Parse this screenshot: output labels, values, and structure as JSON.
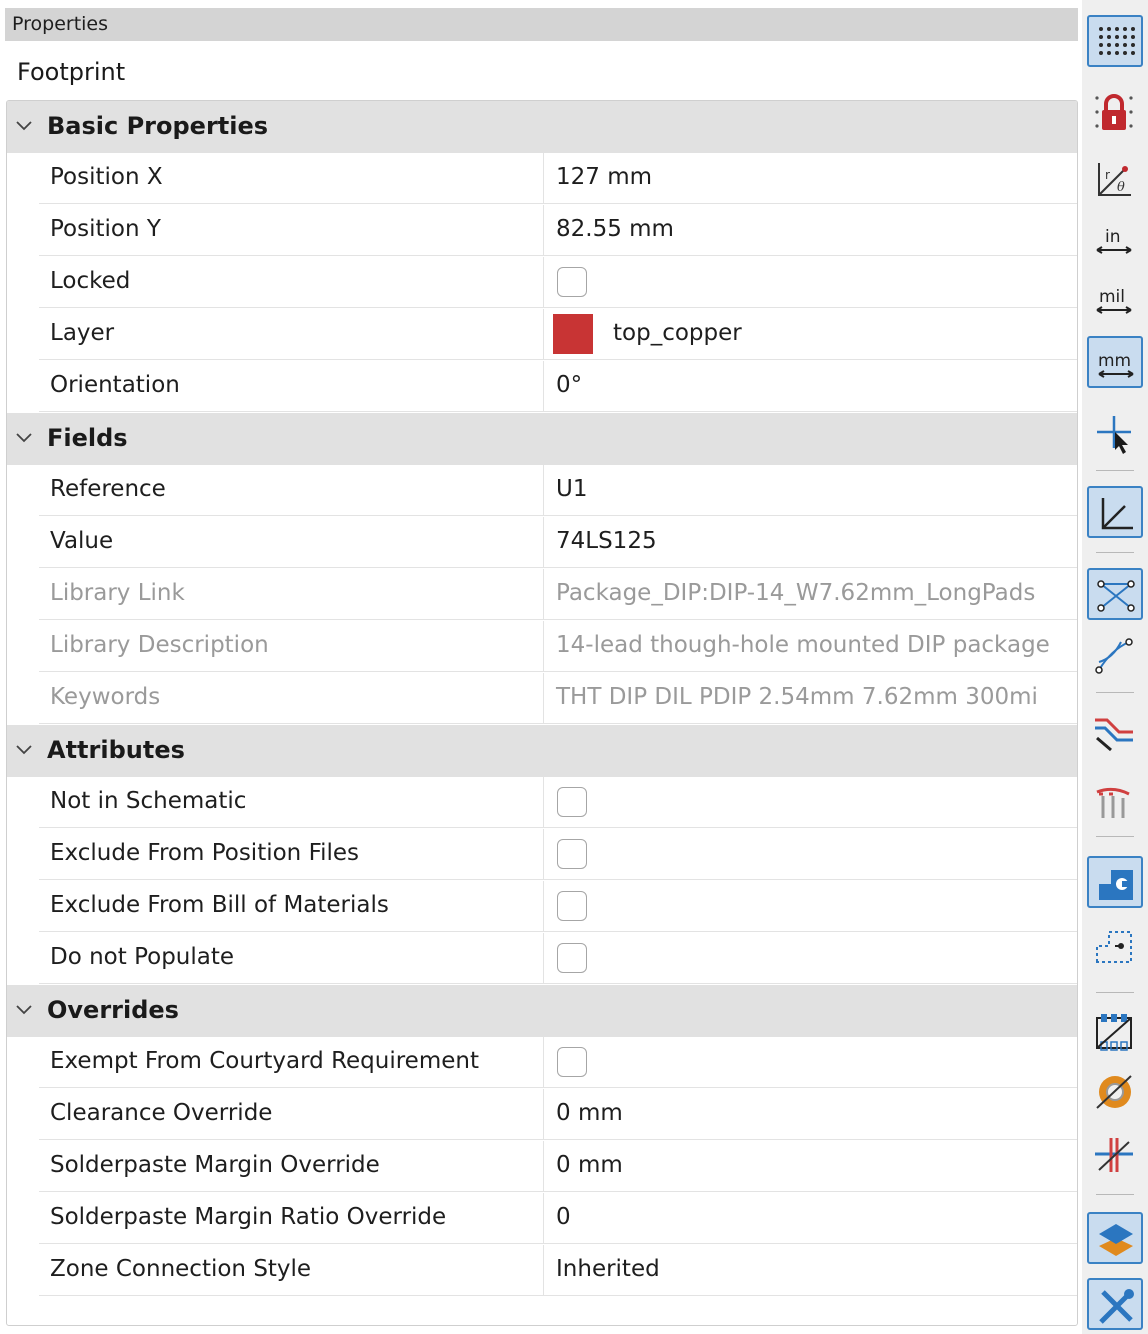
{
  "panel": {
    "title": "Properties",
    "item_type": "Footprint",
    "groups": [
      {
        "label": "Basic Properties",
        "rows": [
          {
            "name": "Position X",
            "value": "127 mm",
            "kind": "text"
          },
          {
            "name": "Position Y",
            "value": "82.55 mm",
            "kind": "text"
          },
          {
            "name": "Locked",
            "checked": false,
            "kind": "checkbox"
          },
          {
            "name": "Layer",
            "value": "top_copper",
            "kind": "layer",
            "color": "#c83434"
          },
          {
            "name": "Orientation",
            "value": "0°",
            "kind": "text"
          }
        ]
      },
      {
        "label": "Fields",
        "rows": [
          {
            "name": "Reference",
            "value": "U1",
            "kind": "text"
          },
          {
            "name": "Value",
            "value": "74LS125",
            "kind": "text"
          },
          {
            "name": "Library Link",
            "value": "Package_DIP:DIP-14_W7.62mm_LongPads",
            "kind": "text",
            "disabled": true
          },
          {
            "name": "Library Description",
            "value": "14-lead though-hole mounted DIP package",
            "kind": "text",
            "disabled": true
          },
          {
            "name": "Keywords",
            "value": "THT DIP DIL PDIP 2.54mm 7.62mm 300mi",
            "kind": "text",
            "disabled": true
          }
        ]
      },
      {
        "label": "Attributes",
        "rows": [
          {
            "name": "Not in Schematic",
            "checked": false,
            "kind": "checkbox"
          },
          {
            "name": "Exclude From Position Files",
            "checked": false,
            "kind": "checkbox"
          },
          {
            "name": "Exclude From Bill of Materials",
            "checked": false,
            "kind": "checkbox"
          },
          {
            "name": "Do not Populate",
            "checked": false,
            "kind": "checkbox"
          }
        ]
      },
      {
        "label": "Overrides",
        "rows": [
          {
            "name": "Exempt From Courtyard Requirement",
            "checked": false,
            "kind": "checkbox"
          },
          {
            "name": "Clearance Override",
            "value": "0 mm",
            "kind": "text"
          },
          {
            "name": "Solderpaste Margin Override",
            "value": "0 mm",
            "kind": "text"
          },
          {
            "name": "Solderpaste Margin Ratio Override",
            "value": "0",
            "kind": "text"
          },
          {
            "name": "Zone Connection Style",
            "value": "Inherited",
            "kind": "text"
          }
        ]
      }
    ]
  },
  "toolbar": {
    "buttons": [
      {
        "icon": "grid-icon",
        "active": true
      },
      {
        "icon": "lock-grid-icon",
        "active": false
      },
      {
        "icon": "polar-coords-icon",
        "active": false
      },
      {
        "icon": "units-inches-icon",
        "label": "in",
        "active": false
      },
      {
        "icon": "units-mils-icon",
        "label": "mil",
        "active": false
      },
      {
        "icon": "units-mm-icon",
        "label": "mm",
        "active": true
      },
      {
        "icon": "full-crosshair-icon",
        "active": false
      },
      {
        "icon": "angle-snap-icon",
        "active": true
      },
      {
        "icon": "ratsnest-icon",
        "active": true
      },
      {
        "icon": "curved-ratsnest-icon",
        "active": false
      },
      {
        "icon": "net-color-icon",
        "active": false
      },
      {
        "icon": "track-outline-icon",
        "active": false
      },
      {
        "icon": "pad-fill-icon",
        "active": true
      },
      {
        "icon": "via-outline-icon",
        "active": false
      },
      {
        "icon": "footprint-outline-icon",
        "active": false
      },
      {
        "icon": "zone-display-icon",
        "active": false
      },
      {
        "icon": "highlight-net-icon",
        "active": false
      },
      {
        "icon": "layers-manager-icon",
        "active": true
      },
      {
        "icon": "properties-tools-icon",
        "active": true
      }
    ],
    "colors": {
      "accent": "#3a82c4",
      "active_bg": "#c9dcef",
      "copper": "#c83434"
    }
  }
}
